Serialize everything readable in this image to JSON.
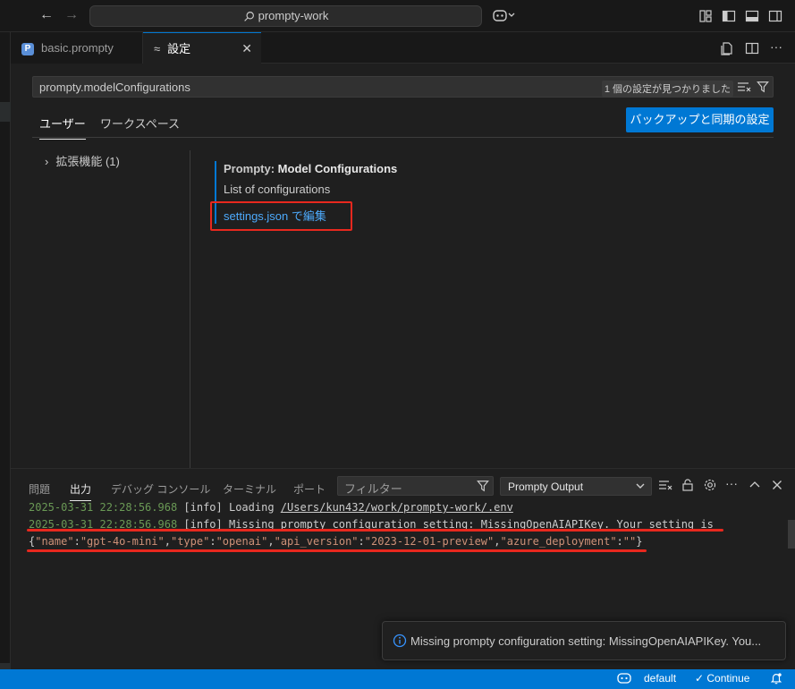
{
  "titlebar": {
    "search_text": "prompty-work"
  },
  "tabs": [
    {
      "label": "basic.prompty"
    },
    {
      "label": "設定"
    }
  ],
  "settings": {
    "search_value": "prompty.modelConfigurations",
    "result_count": "1 個の設定が見つかりました",
    "scopes": {
      "user": "ユーザー",
      "workspace": "ワークスペース"
    },
    "sync_button": "バックアップと同期の設定",
    "toc_item": "拡張機能 (1)",
    "setting_category": "Prompty: ",
    "setting_name": "Model Configurations",
    "setting_description": "List of configurations",
    "edit_link": "settings.json で編集"
  },
  "panel": {
    "tabs": {
      "problems": "問題",
      "output": "出力",
      "debug_console": "デバッグ コンソール",
      "terminal": "ターミナル",
      "ports": "ポート"
    },
    "filter_placeholder": "フィルター",
    "channel": "Prompty Output",
    "log": [
      {
        "timestamp": "2025-03-31 22:28:56.968",
        "level": " [info] ",
        "prefix": "Loading ",
        "path": "/Users/kun432/work/prompty-work/.env"
      },
      {
        "timestamp": "2025-03-31 22:28:56.968",
        "level": " [info] ",
        "text": "Missing prompty configuration setting: MissingOpenAIAPIKey. Your setting is"
      }
    ],
    "json_line": {
      "open": "{",
      "name_key": "\"name\"",
      "name_val": "\"gpt-4o-mini\"",
      "type_key": "\"type\"",
      "type_val": "\"openai\"",
      "ver_key": "\"api_version\"",
      "ver_val": "\"2023-12-01-preview\"",
      "dep_key": "\"azure_deployment\"",
      "dep_val": "\"\"",
      "close": "}"
    }
  },
  "notification": {
    "message": "Missing prompty configuration setting: MissingOpenAIAPIKey. You..."
  },
  "statusbar": {
    "profile": "default",
    "continue": "Continue"
  },
  "colors": {
    "accent": "#0078d4",
    "annotation_red": "#e8281e",
    "link": "#4daafc"
  }
}
